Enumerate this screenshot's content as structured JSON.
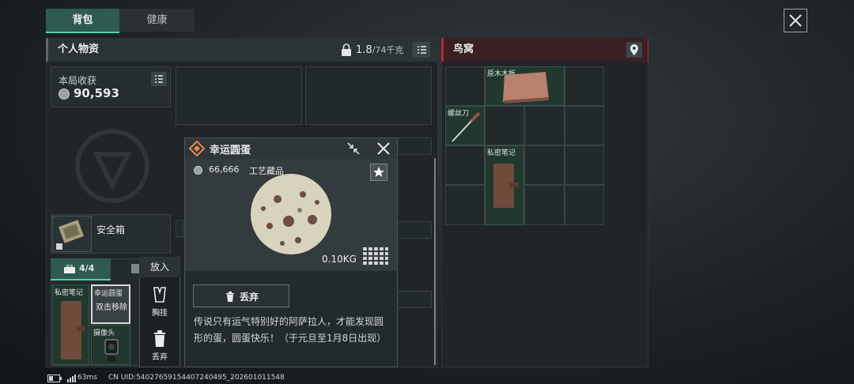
{
  "tabs": [
    {
      "label": "背包"
    },
    {
      "label": "健康"
    }
  ],
  "left_panel": {
    "title": "个人物资",
    "weight": "1.8",
    "weight_max": "/74千克",
    "earnings_label": "本局收获",
    "earnings_value": "90,593",
    "safe_box_label": "安全箱",
    "pocket_count": "4/4",
    "pocket_items": [
      {
        "label": "私密笔记"
      },
      {
        "label": "幸运圆蛋",
        "overlay": "双击移除"
      },
      {
        "label": "摄像头"
      }
    ]
  },
  "right_panel": {
    "title": "鸟窝",
    "items": [
      {
        "label": "原木木板"
      },
      {
        "label": "螺丝刀"
      },
      {
        "label": "私密笔记"
      }
    ]
  },
  "tooltip": {
    "title": "幸运圆蛋",
    "price": "66,666",
    "category": "工艺藏品",
    "weight": "0.10KG",
    "discard_label": "丢弃",
    "description": "传说只有运气特别好的阿萨拉人，才能发现圆形的蛋，圆蛋快乐！（于元旦至1月8日出现）"
  },
  "context_menu": {
    "header": "放入",
    "items": [
      {
        "label": "胸挂"
      },
      {
        "label": "丢弃"
      }
    ]
  },
  "status_bar": {
    "ping": "63ms",
    "uid": "CN UID:54027659154407240495_202601011548"
  },
  "colors": {
    "accent": "#4fd3a3",
    "alert_red": "#b02a36"
  }
}
